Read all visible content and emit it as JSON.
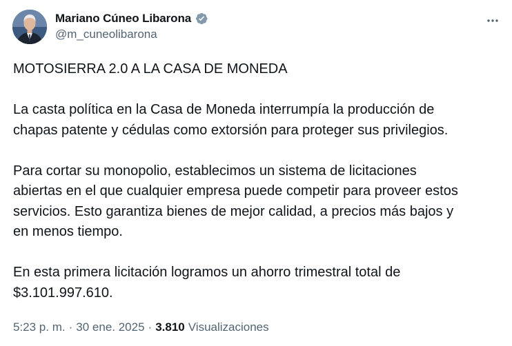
{
  "author": {
    "display_name": "Mariano Cúneo Libarona",
    "handle": "@m_cuneolibarona",
    "verified": true,
    "verified_color": "#829aab"
  },
  "menu_icon": "more-horizontal-icon",
  "tweet": {
    "paragraphs": [
      "MOTOSIERRA 2.0 A LA CASA DE MONEDA",
      "La casta política en la Casa de Moneda interrumpía la producción de\nchapas patente y cédulas como extorsión para proteger sus privilegios.",
      "Para cortar su monopolio, establecimos un sistema de licitaciones\nabiertas en el que cualquier empresa puede competir para proveer estos\nservicios. Esto garantiza bienes de mejor calidad, a precios más bajos y\nen menos tiempo.",
      "En esta primera licitación logramos un ahorro trimestral total de\n$3.101.997.610."
    ]
  },
  "meta": {
    "time": "5:23 p. m.",
    "separator": "·",
    "date": "30 ene. 2025",
    "views_count": "3.810",
    "views_label": "Visualizaciones"
  },
  "colors": {
    "text_primary": "#0f1419",
    "text_secondary": "#536471"
  }
}
